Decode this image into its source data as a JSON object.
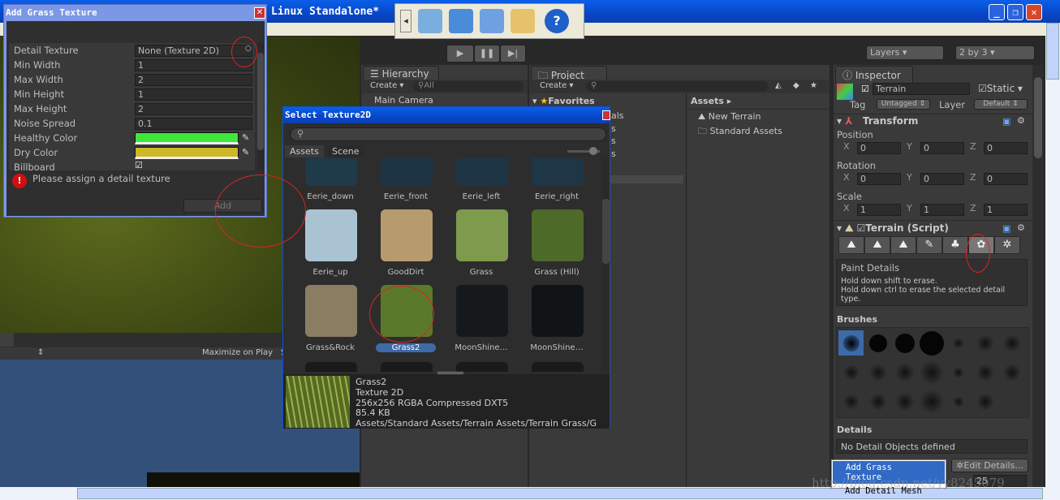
{
  "window": {
    "title": "Linux Standalone*"
  },
  "toolbar": {
    "icons": [
      "back-arrow-icon",
      "user-check-icon",
      "hand-icon",
      "users-icon",
      "document-export-icon",
      "help-icon"
    ]
  },
  "play": {
    "play": "▶",
    "pause": "❚❚",
    "step": "▶|"
  },
  "layers": {
    "label": "Layers",
    "layout": "2 by 3"
  },
  "hierarchy": {
    "tab": "Hierarchy",
    "create": "Create",
    "search": "All",
    "items": [
      "Main Camera"
    ]
  },
  "project": {
    "tab": "Project",
    "create": "Create",
    "favorites": "Favorites",
    "fav_partial": [
      "als",
      "s",
      "s",
      "s"
    ],
    "assets_header": "Assets",
    "assets": [
      "New Terrain",
      "Standard Assets"
    ]
  },
  "game": {
    "maximize": "Maximize on Play",
    "s": "S"
  },
  "add_grass": {
    "title": "Add Grass Texture",
    "fields": [
      {
        "label": "Detail Texture",
        "value": "None (Texture 2D)"
      },
      {
        "label": "Min Width",
        "value": "1"
      },
      {
        "label": "Max Width",
        "value": "2"
      },
      {
        "label": "Min Height",
        "value": "1"
      },
      {
        "label": "Max Height",
        "value": "2"
      },
      {
        "label": "Noise Spread",
        "value": "0.1"
      }
    ],
    "healthy_label": "Healthy Color",
    "healthy_color": "#3de83a",
    "dry_label": "Dry Color",
    "dry_color": "#cdb826",
    "billboard_label": "Billboard",
    "billboard_checked": true,
    "error": "Please assign a detail texture",
    "add": "Add"
  },
  "select_texture": {
    "title": "Select Texture2D",
    "search": "",
    "tabs": [
      "Assets",
      "Scene"
    ],
    "items": [
      {
        "name": "Eerie_down",
        "color": "#1f3a48"
      },
      {
        "name": "Eerie_front",
        "color": "#1d3444"
      },
      {
        "name": "Eerie_left",
        "color": "#1e3545"
      },
      {
        "name": "Eerie_right",
        "color": "#1f3647"
      },
      {
        "name": "Eerie_up",
        "color": "#a9c3d2"
      },
      {
        "name": "GoodDirt",
        "color": "#b79a6e"
      },
      {
        "name": "Grass",
        "color": "#7e9a4c"
      },
      {
        "name": "Grass (Hill)",
        "color": "#4d6a28"
      },
      {
        "name": "Grass&Rock",
        "color": "#8a7d62"
      },
      {
        "name": "Grass2",
        "color": "#5a7a2a"
      },
      {
        "name": "MoonShine…",
        "color": "#15191b"
      },
      {
        "name": "MoonShine…",
        "color": "#111416"
      }
    ],
    "selected": "Grass2",
    "preview": {
      "name": "Grass2",
      "type": "Texture 2D",
      "info": "256x256  RGBA Compressed DXT5",
      "size": "85.4 KB",
      "path": "Assets/Standard Assets/Terrain Assets/Terrain Grass/G"
    }
  },
  "inspector": {
    "tab": "Inspector",
    "name": "Terrain",
    "static": "Static",
    "tag_label": "Tag",
    "tag": "Untagged",
    "layer_label": "Layer",
    "layer": "Default",
    "transform": "Transform",
    "position": "Position",
    "rotation": "Rotation",
    "scale": "Scale",
    "pos": [
      "0",
      "0",
      "0"
    ],
    "rot": [
      "0",
      "0",
      "0"
    ],
    "scl": [
      "1",
      "1",
      "1"
    ],
    "axes": [
      "X",
      "Y",
      "Z"
    ],
    "terrain_script": "Terrain (Script)",
    "tools": [
      "raise-terrain-icon",
      "paint-height-icon",
      "smooth-height-icon",
      "paint-texture-icon",
      "place-trees-icon",
      "paint-details-icon",
      "settings-gear-icon"
    ],
    "paint_title": "Paint Details",
    "paint_help": "Hold down shift to erase.\nHold down ctrl to erase the selected detail type.",
    "brushes": "Brushes",
    "details": "Details",
    "no_details": "No Detail Objects defined",
    "edit_details": "Edit Details...",
    "number": "25"
  },
  "context_menu": {
    "items": [
      "Add Grass Texture",
      "Add Detail Mesh"
    ],
    "selected": "Add Grass Texture"
  },
  "annotations": [
    "3",
    "4",
    "5",
    "6"
  ],
  "watermark": "http://blog.csdn.net/yy8245079"
}
